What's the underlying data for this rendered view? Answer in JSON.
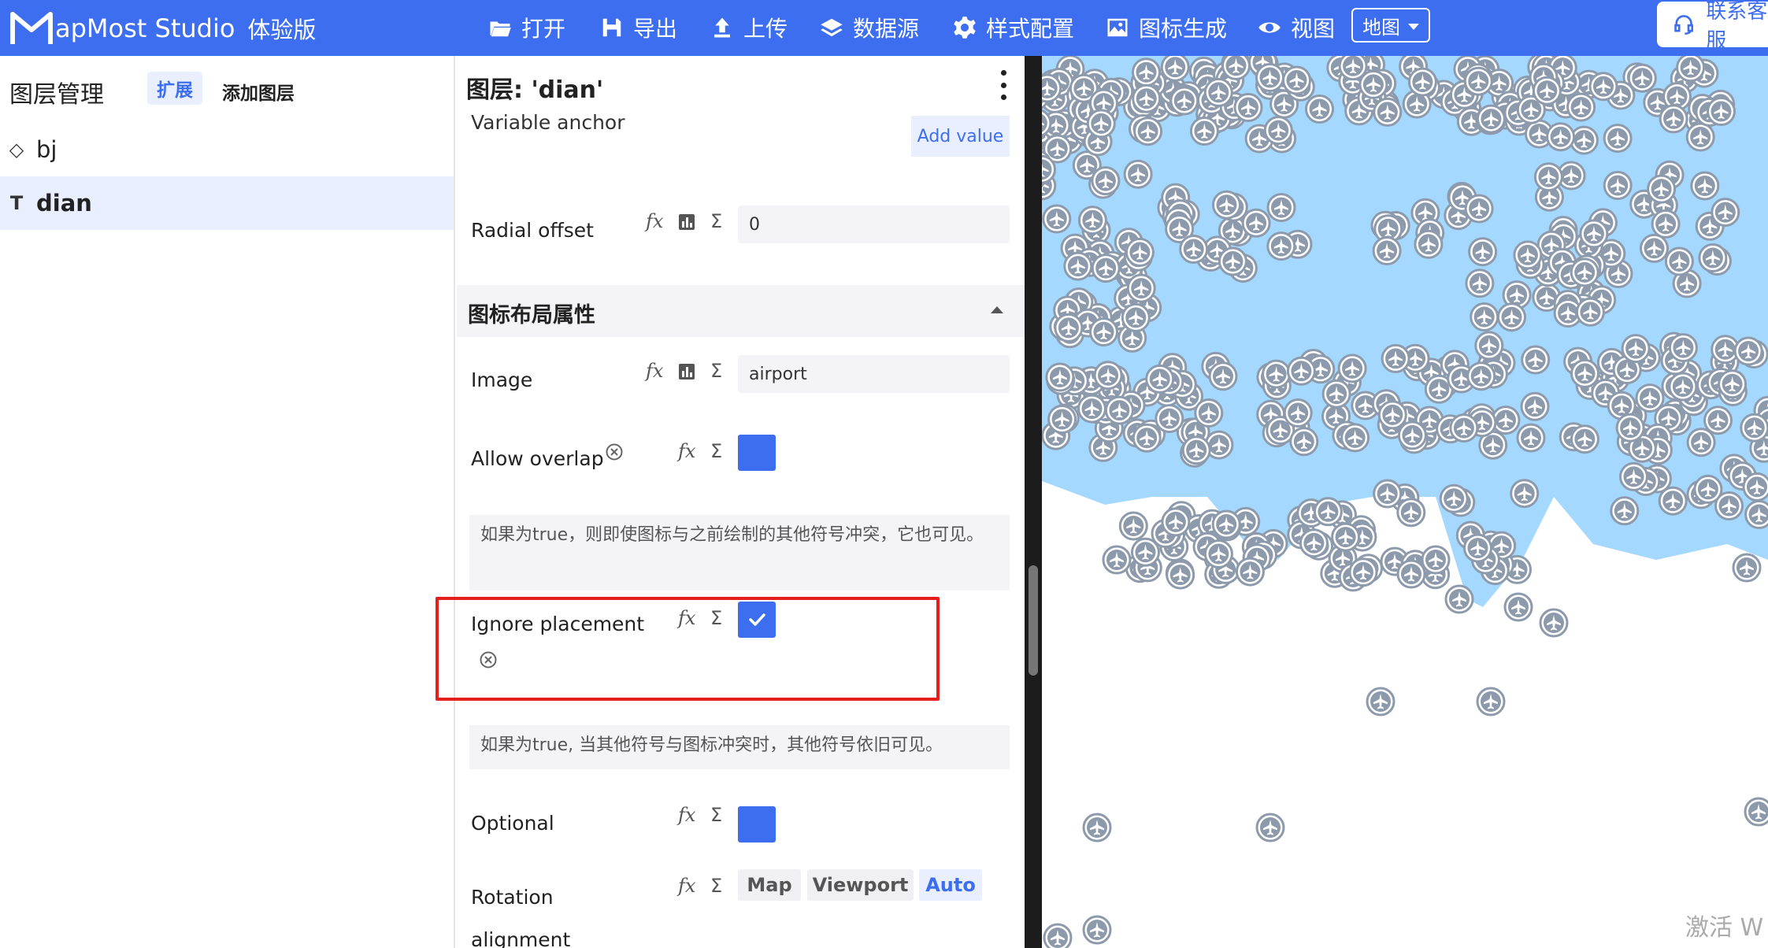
{
  "header": {
    "logo_text": "apMost Studio",
    "logo_suffix": "体验版",
    "nav": [
      {
        "label": "打开",
        "icon": "folder-open-icon"
      },
      {
        "label": "导出",
        "icon": "save-icon"
      },
      {
        "label": "上传",
        "icon": "upload-icon"
      },
      {
        "label": "数据源",
        "icon": "layers-icon"
      },
      {
        "label": "样式配置",
        "icon": "gear-icon"
      },
      {
        "label": "图标生成",
        "icon": "image-icon"
      },
      {
        "label": "视图",
        "icon": "eye-icon"
      }
    ],
    "view_select": "地图",
    "contact": "联系客服"
  },
  "left_panel": {
    "title": "图层管理",
    "tab_expand": "扩展",
    "tab_add": "添加图层",
    "layers": [
      {
        "icon": "◇",
        "name": "bj"
      },
      {
        "icon": "T",
        "name": "dian"
      }
    ]
  },
  "editor": {
    "title": "图层: 'dian'",
    "variable_anchor_label": "Variable anchor",
    "add_value": "Add value",
    "radial_offset_label": "Radial offset",
    "radial_offset_value": "0",
    "section_title": "图标布局属性",
    "image_label": "Image",
    "image_value": "airport",
    "allow_overlap_label": "Allow overlap",
    "allow_overlap_desc": "如果为true，则即使图标与之前绘制的其他符号冲突，它也可见。",
    "ignore_placement_label": "Ignore placement",
    "ignore_placement_desc": "如果为true, 当其他符号与图标冲突时，其他符号依旧可见。",
    "optional_label": "Optional",
    "rotation_label_1": "Rotation",
    "rotation_label_2": "alignment",
    "rotation_options": [
      "Map",
      "Viewport",
      "Auto"
    ],
    "rotation_selected": "Auto",
    "fx": "fx",
    "sigma": "Σ"
  },
  "map": {
    "watermark": "激活 W"
  },
  "colors": {
    "accent": "#3d6ef0",
    "map_water": "#a5d8ff",
    "marker": "#8d9aab",
    "highlight": "#e61e1e"
  }
}
